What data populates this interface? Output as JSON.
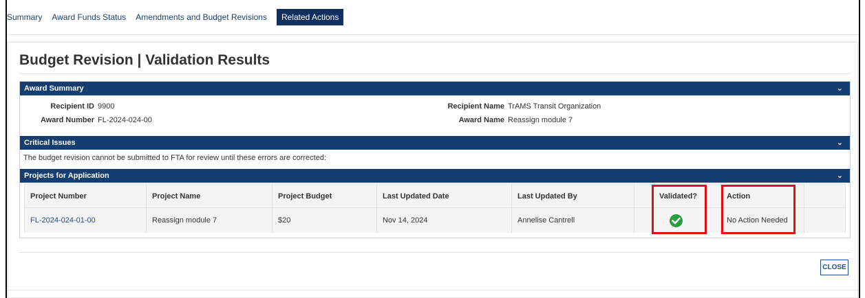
{
  "tabs": [
    {
      "label": "Summary"
    },
    {
      "label": "Award Funds Status"
    },
    {
      "label": "Amendments and Budget Revisions"
    },
    {
      "label": "Related Actions"
    }
  ],
  "modal": {
    "title": "Budget Revision | Validation Results",
    "close_label": "CLOSE"
  },
  "award_summary": {
    "header": "Award Summary",
    "recipient_id_label": "Recipient ID",
    "recipient_id": "9900",
    "award_number_label": "Award Number",
    "award_number": "FL-2024-024-00",
    "recipient_name_label": "Recipient Name",
    "recipient_name": "TrAMS Transit Organization",
    "award_name_label": "Award Name",
    "award_name": "Reassign module 7"
  },
  "critical_issues": {
    "header": "Critical Issues",
    "message": "The budget revision cannot be submitted to FTA for review until these errors are corrected:"
  },
  "projects": {
    "header": "Projects for Application",
    "columns": [
      "Project Number",
      "Project Name",
      "Project Budget",
      "Last Updated Date",
      "Last Updated By",
      "Validated?",
      "Action"
    ],
    "rows": [
      {
        "project_number": "FL-2024-024-01-00",
        "project_name": "Reassign module 7",
        "project_budget": "$20",
        "last_updated_date": "Nov 14, 2024",
        "last_updated_by": "Annelise Cantrell",
        "validated_icon": "check-circle-icon",
        "action": "No Action Needed"
      }
    ]
  },
  "colors": {
    "header_bg": "#163d70",
    "active_tab_bg": "#12305f",
    "link": "#1f4f8f",
    "check": "#2a9d3c",
    "highlight": "#dd1111"
  }
}
